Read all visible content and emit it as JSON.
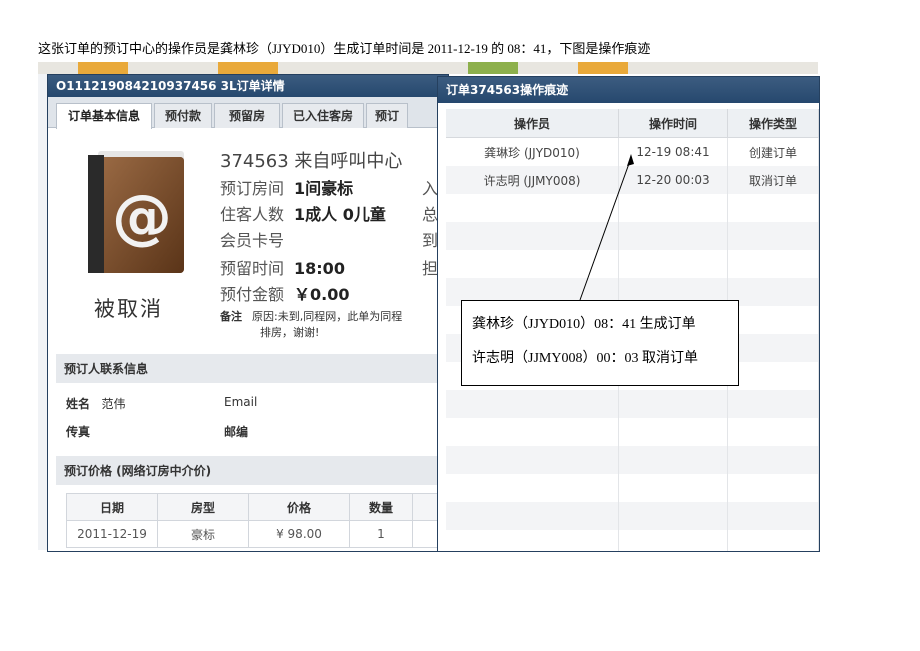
{
  "caption": "这张订单的预订中心的操作员是龚林珍（JJYD010）生成订单时间是 2011-12-19 的 08：41，下图是操作痕迹",
  "left_dialog": {
    "title": "O111219084210937456 3L订单详情",
    "tabs": [
      "订单基本信息",
      "预付款",
      "预留房",
      "已入住客房",
      "预订"
    ],
    "status_stamp": "被取消",
    "headline": "374563 来自呼叫中心",
    "fields": [
      {
        "label": "预订房间",
        "value": "1间豪标",
        "cut": "入"
      },
      {
        "label": "住客人数",
        "value": "1成人 0儿童",
        "cut": "总"
      },
      {
        "label": "会员卡号",
        "value": "",
        "cut": "到"
      },
      {
        "label": "预留时间",
        "value": "18:00",
        "cut": "担"
      },
      {
        "label": "预付金额",
        "value": "￥0.00",
        "cut": ""
      }
    ],
    "note_label": "备注",
    "note_text_1": "原因:未到,同程网，此单为同程",
    "note_text_2": "排房，谢谢!",
    "contact_section": "预订人联系信息",
    "name_label": "姓名",
    "name_value": "范伟",
    "email_label": "Email",
    "fax_label": "传真",
    "zip_label": "邮编",
    "price_section": "预订价格 (网络订房中介价)",
    "price_headers": [
      "日期",
      "房型",
      "价格",
      "数量"
    ],
    "price_row": [
      "2011-12-19",
      "豪标",
      "¥ 98.00",
      "1"
    ]
  },
  "right_dialog": {
    "title": "订单374563操作痕迹",
    "headers": [
      "操作员",
      "操作时间",
      "操作类型"
    ],
    "rows": [
      [
        "龚琳珍 (JJYD010)",
        "12-19 08:41",
        "创建订单"
      ],
      [
        "许志明 (JJMY008)",
        "12-20 00:03",
        "取消订单"
      ]
    ]
  },
  "annotation": {
    "line1": "龚林珍（JJYD010）08：41 生成订单",
    "line2": "许志明（JJMY008）00：03 取消订单"
  },
  "colors": {
    "titlebar": "#26486e",
    "book_cover": "#7a4a2a",
    "book_spine": "#222222"
  }
}
